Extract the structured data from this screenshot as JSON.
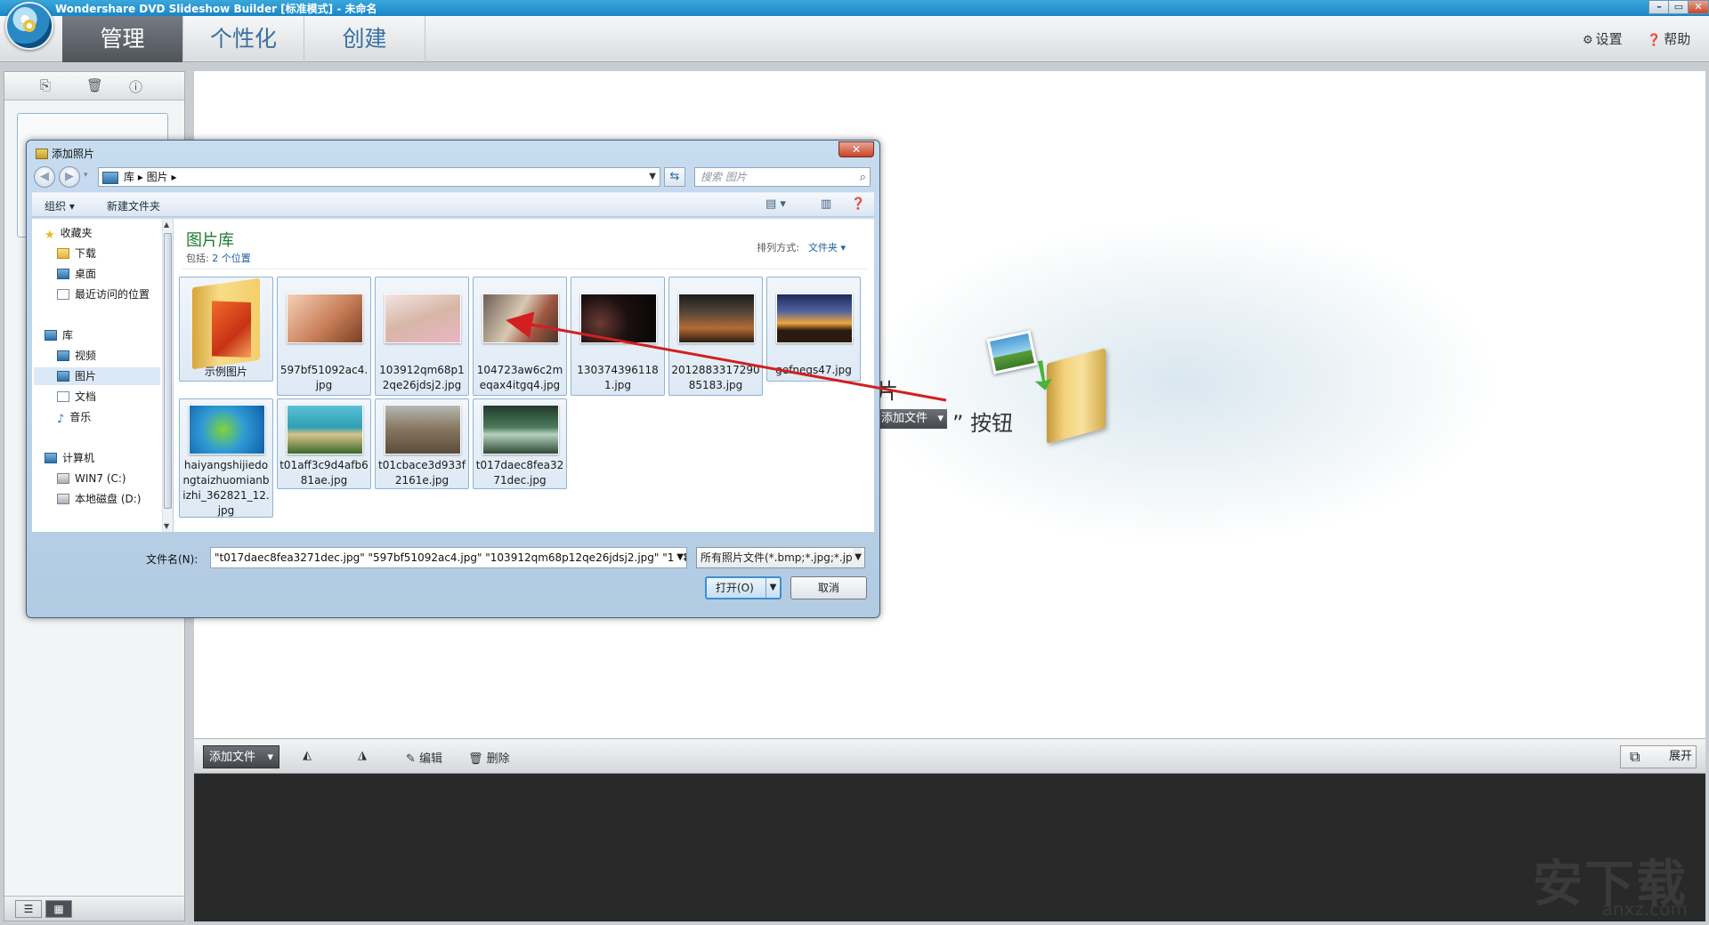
{
  "app": {
    "title": "Wondershare DVD Slideshow Builder [标准模式] - 未命名",
    "window_controls": [
      "–",
      "▭",
      "✕"
    ],
    "tabs": [
      {
        "label": "管理",
        "active": true
      },
      {
        "label": "个性化",
        "active": false
      },
      {
        "label": "创建",
        "active": false
      }
    ],
    "settings_label": "设置",
    "help_label": "帮助",
    "canvas_hint_line1": "片",
    "canvas_hint_btn": "添加文件",
    "canvas_hint_line2": "” 按钮",
    "bottom_toolbar": {
      "add_file": "添加文件",
      "edit": "编辑",
      "delete": "删除",
      "expand": "展开"
    },
    "watermark": "安下载",
    "watermark_sub": "anxz.com"
  },
  "dialog": {
    "title": "添加照片",
    "close": "✕",
    "breadcrumb": "库  ▸  图片  ▸",
    "search_placeholder": "搜索 图片",
    "organize": "组织 ▾",
    "new_folder": "新建文件夹",
    "nav": {
      "favorites": "收藏夹",
      "downloads": "下载",
      "desktop": "桌面",
      "recent": "最近访问的位置",
      "libraries": "库",
      "videos": "视频",
      "pictures": "图片",
      "documents": "文档",
      "music": "音乐",
      "computer": "计算机",
      "drive_c": "WIN7 (C:)",
      "drive_d": "本地磁盘 (D:)"
    },
    "library_title": "图片库",
    "library_includes": "包括:",
    "library_locations": "2 个位置",
    "sort_label": "排列方式:",
    "sort_value": "文件夹 ▾",
    "files": [
      {
        "name": "示例图片"
      },
      {
        "name": "597bf51092ac4.jpg"
      },
      {
        "name": "103912qm68p12qe26jdsj2.jpg"
      },
      {
        "name": "104723aw6c2meqax4itgq4.jpg"
      },
      {
        "name": "1303743961181.jpg"
      },
      {
        "name": "201288331729085183.jpg"
      },
      {
        "name": "gefnegs47.jpg"
      },
      {
        "name": "haiyangshijiedongtaizhuomianbizhi_362821_12.jpg"
      },
      {
        "name": "t01aff3c9d4afb681ae.jpg"
      },
      {
        "name": "t01cbace3d933f2161e.jpg"
      },
      {
        "name": "t017daec8fea3271dec.jpg"
      }
    ],
    "filename_label": "文件名(N):",
    "filename_value": "\"t017daec8fea3271dec.jpg\" \"597bf51092ac4.jpg\" \"103912qm68p12qe26jdsj2.jpg\" \"1047...",
    "filetype_value": "所有照片文件(*.bmp;*.jpg;*.jp",
    "open_button": "打开(O)",
    "cancel_button": "取消"
  },
  "colors": {
    "accent": "#3b8fd4",
    "library_title": "#1e7a31",
    "annotation_arrow": "#d21f1f"
  }
}
